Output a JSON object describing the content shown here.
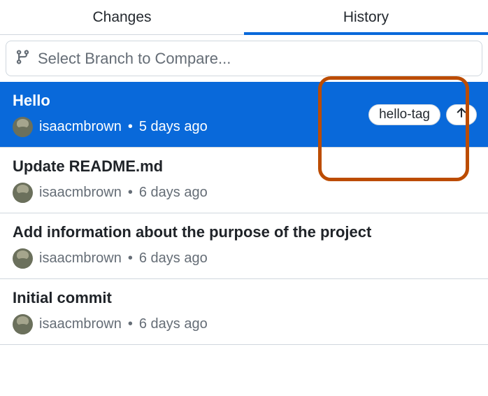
{
  "tabs": {
    "changes": "Changes",
    "history": "History"
  },
  "branch_selector": {
    "placeholder": "Select Branch to Compare..."
  },
  "commits": [
    {
      "title": "Hello",
      "author": "isaacmbrown",
      "time": "5 days ago",
      "tag": "hello-tag"
    },
    {
      "title": "Update README.md",
      "author": "isaacmbrown",
      "time": "6 days ago"
    },
    {
      "title": "Add information about the purpose of the project",
      "author": "isaacmbrown",
      "time": "6 days ago"
    },
    {
      "title": "Initial commit",
      "author": "isaacmbrown",
      "time": "6 days ago"
    }
  ],
  "separator": "•"
}
